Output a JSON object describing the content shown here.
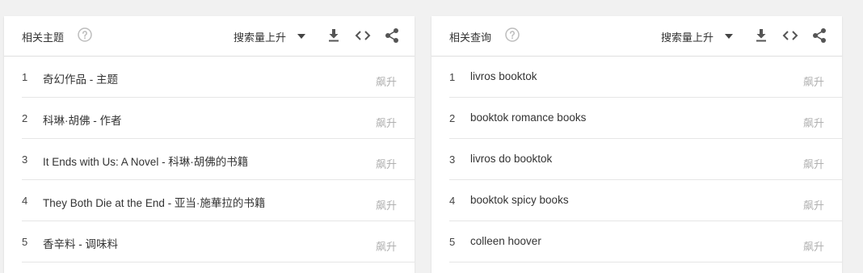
{
  "panels": [
    {
      "title": "相关主题",
      "sort_label": "搜索量上升",
      "rows": [
        {
          "index": "1",
          "label": "奇幻作品 - 主题",
          "value": "飙升"
        },
        {
          "index": "2",
          "label": "科琳·胡佛 - 作者",
          "value": "飙升"
        },
        {
          "index": "3",
          "label": "It Ends with Us: A Novel - 科琳·胡佛的书籍",
          "value": "飙升"
        },
        {
          "index": "4",
          "label": "They Both Die at the End - 亚当·施華拉的书籍",
          "value": "飙升"
        },
        {
          "index": "5",
          "label": "香辛料 - 调味料",
          "value": "飙升"
        }
      ]
    },
    {
      "title": "相关查询",
      "sort_label": "搜索量上升",
      "rows": [
        {
          "index": "1",
          "label": "livros booktok",
          "value": "飙升"
        },
        {
          "index": "2",
          "label": "booktok romance books",
          "value": "飙升"
        },
        {
          "index": "3",
          "label": "livros do booktok",
          "value": "飙升"
        },
        {
          "index": "4",
          "label": "booktok spicy books",
          "value": "飙升"
        },
        {
          "index": "5",
          "label": "colleen hoover",
          "value": "飙升"
        }
      ]
    }
  ],
  "icons": {
    "help": "help-circle-icon",
    "caret": "caret-down-icon",
    "download": "download-icon",
    "embed": "embed-code-icon",
    "share": "share-icon"
  },
  "colors": {
    "icon_gray": "#bdbdbd",
    "tool_gray": "#555555",
    "value_gray": "#b0b0b0"
  }
}
